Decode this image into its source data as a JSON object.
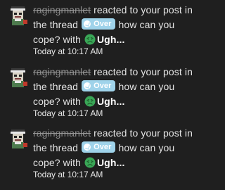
{
  "alerts": [
    {
      "username": "ragingmanlet",
      "action_text": "reacted to your post in the thread",
      "prefix_label": "Over",
      "thread_title": "how can you cope?",
      "with_text": "with",
      "reaction_label": "Ugh...",
      "time": "Today at 10:17 AM"
    },
    {
      "username": "ragingmanlet",
      "action_text": "reacted to your post in the thread",
      "prefix_label": "Over",
      "thread_title": "how can you cope?",
      "with_text": "with",
      "reaction_label": "Ugh...",
      "time": "Today at 10:17 AM"
    },
    {
      "username": "ragingmanlet",
      "action_text": "reacted to your post in the thread",
      "prefix_label": "Over",
      "thread_title": "how can you cope?",
      "with_text": "with",
      "reaction_label": "Ugh...",
      "time": "Today at 10:17 AM"
    }
  ],
  "colors": {
    "background": "#1f1f1f",
    "prefix_badge": "#9fd3ea",
    "username": "#8c8c8c",
    "reaction_emoji": "#3aa757"
  }
}
